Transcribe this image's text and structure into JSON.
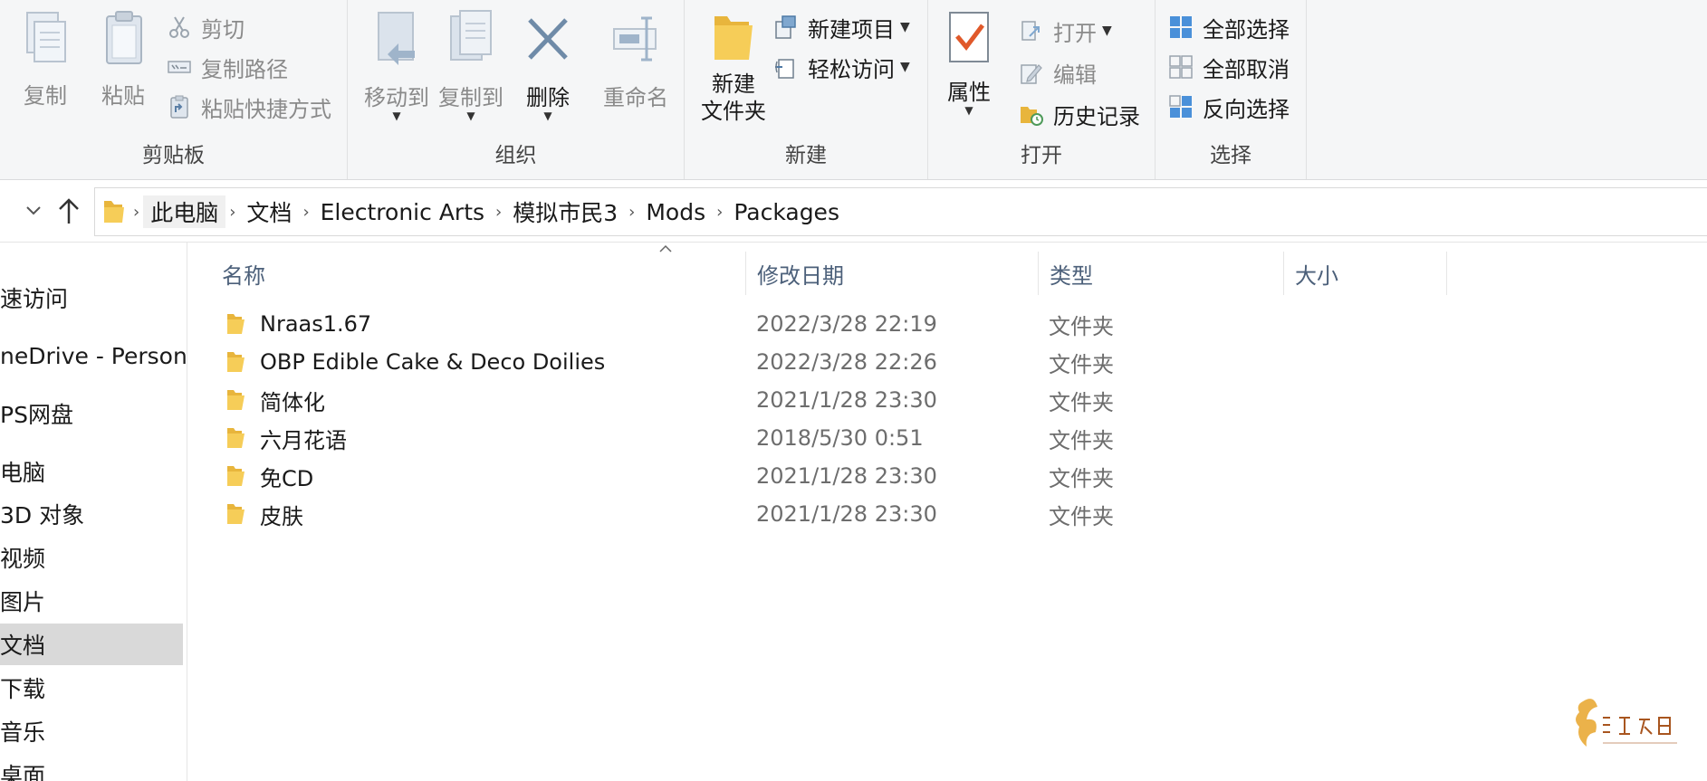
{
  "ribbon": {
    "clipboard": {
      "label": "剪贴板",
      "copy": "复制",
      "paste": "粘贴",
      "cut": "剪切",
      "copy_path": "复制路径",
      "paste_shortcut": "粘贴快捷方式"
    },
    "organize": {
      "label": "组织",
      "move_to": "移动到",
      "copy_to": "复制到",
      "delete": "删除",
      "rename": "重命名"
    },
    "new": {
      "label": "新建",
      "new_folder_line1": "新建",
      "new_folder_line2": "文件夹",
      "new_item": "新建项目",
      "easy_access": "轻松访问"
    },
    "open": {
      "label": "打开",
      "properties": "属性",
      "open": "打开",
      "edit": "编辑",
      "history": "历史记录"
    },
    "select": {
      "label": "选择",
      "select_all": "全部选择",
      "select_none": "全部取消",
      "invert": "反向选择"
    }
  },
  "address": {
    "crumbs": [
      "此电脑",
      "文档",
      "Electronic Arts",
      "模拟市民3",
      "Mods",
      "Packages"
    ]
  },
  "sidebar": {
    "items": [
      "速访问",
      "neDrive - Persona",
      "PS网盘",
      "电脑",
      "3D 对象",
      "视频",
      "图片",
      "文档",
      "下载",
      "音乐",
      "桌面"
    ]
  },
  "columns": {
    "name": "名称",
    "date": "修改日期",
    "type": "类型",
    "size": "大小"
  },
  "files": [
    {
      "name": "Nraas1.67",
      "date": "2022/3/28 22:19",
      "type": "文件夹"
    },
    {
      "name": "OBP Edible Cake & Deco Doilies",
      "date": "2022/3/28 22:26",
      "type": "文件夹"
    },
    {
      "name": "简体化",
      "date": "2021/1/28 23:30",
      "type": "文件夹"
    },
    {
      "name": "六月花语",
      "date": "2018/5/30 0:51",
      "type": "文件夹"
    },
    {
      "name": "免CD",
      "date": "2021/1/28 23:30",
      "type": "文件夹"
    },
    {
      "name": "皮肤",
      "date": "2021/1/28 23:30",
      "type": "文件夹"
    }
  ],
  "colors": {
    "folder": "#f2c04f",
    "header_text": "#4c607a",
    "selected_nav": "#d9d9d9"
  }
}
